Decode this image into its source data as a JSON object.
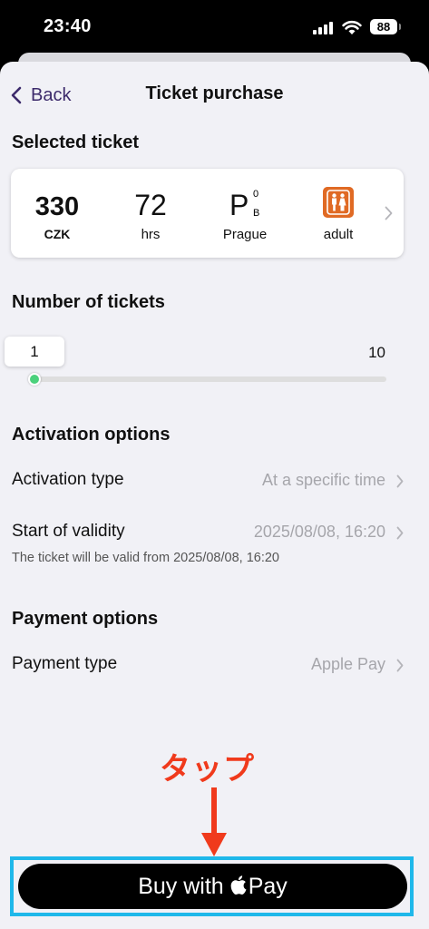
{
  "status_bar": {
    "time": "23:40",
    "battery": "88"
  },
  "nav": {
    "back_label": "Back",
    "title": "Ticket purchase"
  },
  "selected_ticket": {
    "section_title": "Selected ticket",
    "price": "330",
    "currency": "CZK",
    "duration": "72",
    "duration_unit": "hrs",
    "zone_letter": "P",
    "zone_sup": "0",
    "zone_sub": "B",
    "zone_name": "Prague",
    "passenger_type": "adult",
    "passenger_icon": "adult-icon"
  },
  "tickets": {
    "section_title": "Number of tickets",
    "selected": "1",
    "max": "10",
    "slider_fraction": 0
  },
  "activation": {
    "section_title": "Activation options",
    "type_label": "Activation type",
    "type_value": "At a specific time",
    "start_label": "Start of validity",
    "start_value": "2025/08/08, 16:20",
    "note": "The ticket will be valid from 2025/08/08, 16:20"
  },
  "payment": {
    "section_title": "Payment options",
    "type_label": "Payment type",
    "type_value": "Apple Pay"
  },
  "annotation": {
    "text": "タップ"
  },
  "pay_button": {
    "prefix": "Buy with",
    "suffix": "Pay",
    "icon": "apple-icon"
  },
  "colors": {
    "accent": "#3c2a6b",
    "slider": "#4bd17c",
    "annotation": "#f03a1c",
    "highlight": "#1fb8ea",
    "adult_badge": "#e06a24"
  }
}
